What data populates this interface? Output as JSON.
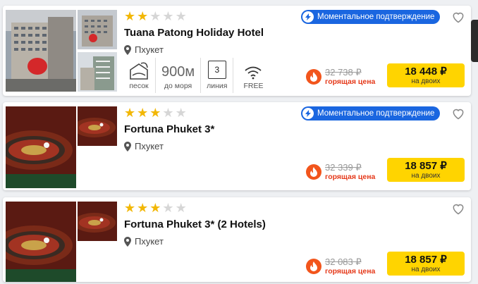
{
  "labels": {
    "badge": "Моментальное подтверждение",
    "hot": "горящая цена",
    "for_two": "на двоих"
  },
  "colors": {
    "accent": "#1a66e0",
    "buy": "#ffd400",
    "hot": "#e5391a",
    "star": "#f2b705"
  },
  "hotels": [
    {
      "stars": 2,
      "name": "Tuana Patong Holiday Hotel",
      "location": "Пхукет",
      "has_badge": true,
      "amenities": {
        "beach_label": "песок",
        "distance_value": "900м",
        "distance_label": "до моря",
        "line_value": "3",
        "line_label": "линия",
        "wifi_label": "FREE"
      },
      "old_price": "32 738 ₽",
      "price": "18 448 ₽"
    },
    {
      "stars": 3,
      "name": "Fortuna Phuket 3*",
      "location": "Пхукет",
      "has_badge": true,
      "old_price": "32 339 ₽",
      "price": "18 857 ₽"
    },
    {
      "stars": 3,
      "name": "Fortuna Phuket 3* (2 Hotels)",
      "location": "Пхукет",
      "has_badge": false,
      "old_price": "32 083 ₽",
      "price": "18 857 ₽"
    }
  ]
}
